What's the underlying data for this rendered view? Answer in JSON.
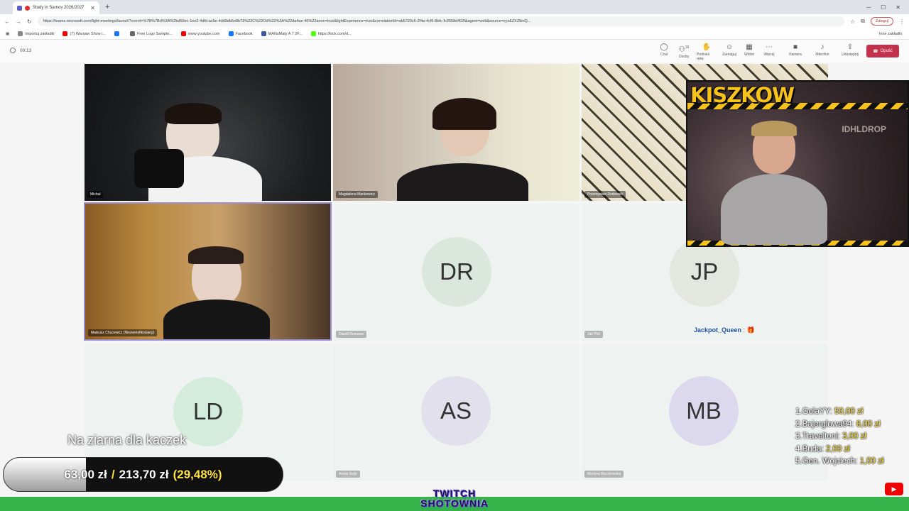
{
  "browser": {
    "tabs": [
      {
        "label": "Study in Sarnov 2026/2027"
      }
    ],
    "url": "https://teams.microsoft.com/light-meetings/launch?correl=%7B%7Bd%3A%2bd59ec-1ee2-4dfd-ac5e-4dd9db5e8b73%22C%22Od%22%3A%22da4ae-45%22anon=true&lightExperience=true&correlationId=ab5720c6-2f4a-4cf6-8bfc-fc9558d402f&agent=web&source=xyz&ZXZlbnQ...",
    "profile_label": "Zaloguj",
    "bookmarks": [
      {
        "label": "Importuj zakładki",
        "color": "#888"
      },
      {
        "label": "(7) Warsaw Show i...",
        "color": "#e00"
      },
      {
        "label": "",
        "color": "#1877f2"
      },
      {
        "label": "Free Logo Sample...",
        "color": "#666"
      },
      {
        "label": "www.youtube.com",
        "color": "#e00"
      },
      {
        "label": "Facebook",
        "color": "#1877f2"
      },
      {
        "label": "MANsMaty A 7 2F...",
        "color": "#3b5998"
      },
      {
        "label": "https://kick.com/d...",
        "color": "#53fc18"
      }
    ],
    "bookmarks_right": "Inne zakładki"
  },
  "teams": {
    "timer": "00:13",
    "toolbar": [
      {
        "label": "Czat",
        "icon": "chat-icon"
      },
      {
        "label": "Osoby",
        "icon": "people-icon",
        "count": "19"
      },
      {
        "label": "Podnieś rękę",
        "icon": "hand-icon"
      },
      {
        "label": "Zareaguj",
        "icon": "react-icon"
      },
      {
        "label": "Widok",
        "icon": "view-icon"
      },
      {
        "label": "Więcej",
        "icon": "more-icon"
      },
      {
        "label": "Kamera",
        "icon": "camera-icon"
      },
      {
        "label": "Mikrofon",
        "icon": "mic-icon"
      },
      {
        "label": "Udostępnij",
        "icon": "share-icon"
      }
    ],
    "leave_label": "Opuść"
  },
  "participants": [
    {
      "name": "Michał",
      "type": "video"
    },
    {
      "name": "Magdalena Markiewicz",
      "type": "video"
    },
    {
      "name": "Przemysław Rodowski",
      "type": "video"
    },
    {
      "name": "Mateusz Chucewicz (Niezweryfikowany)",
      "type": "video"
    },
    {
      "name": "Dawid Romanis",
      "initials": "DR",
      "type": "avatar",
      "color": "#dbe7dd"
    },
    {
      "name": "Jan Piet",
      "initials": "JP",
      "type": "avatar",
      "color": "#e3e7df"
    },
    {
      "name": "",
      "initials": "LD",
      "type": "avatar",
      "color": "#d4ecdc"
    },
    {
      "name": "Aneta Sudy",
      "initials": "AS",
      "type": "avatar",
      "color": "#e3e0ee"
    },
    {
      "name": "Martyna Buczkowska",
      "initials": "MB",
      "type": "avatar",
      "color": "#dcd8ee"
    }
  ],
  "stream": {
    "title": "KISZKOW",
    "sign_text": "IDHLDROP",
    "chat": {
      "user": "Jackpot_Queen",
      "separator": ":",
      "emote": "🎁"
    },
    "leaderboard": [
      {
        "rank": "1.",
        "name": "GolaYY:",
        "amount": "50,00 zł"
      },
      {
        "rank": "2.",
        "name": "Bajerglowa94:",
        "amount": "6,00 zł"
      },
      {
        "rank": "3.",
        "name": "Traveltoni:",
        "amount": "3,00 zł"
      },
      {
        "rank": "4.",
        "name": "Buda:",
        "amount": "2,00 zł"
      },
      {
        "rank": "5.",
        "name": "Gen. Wojciech:",
        "amount": "1,00 zł"
      }
    ],
    "goal": {
      "title": "Na ziarna dla kaczek",
      "current": "63,00 zł",
      "separator": "/",
      "target": "213,70 zł",
      "percent_label": "(29,48%)",
      "fraction": 0.2948
    },
    "logo_lines": [
      "TWITCH",
      "SHOTOWNIA"
    ],
    "yt_icon": "youtube-icon"
  }
}
